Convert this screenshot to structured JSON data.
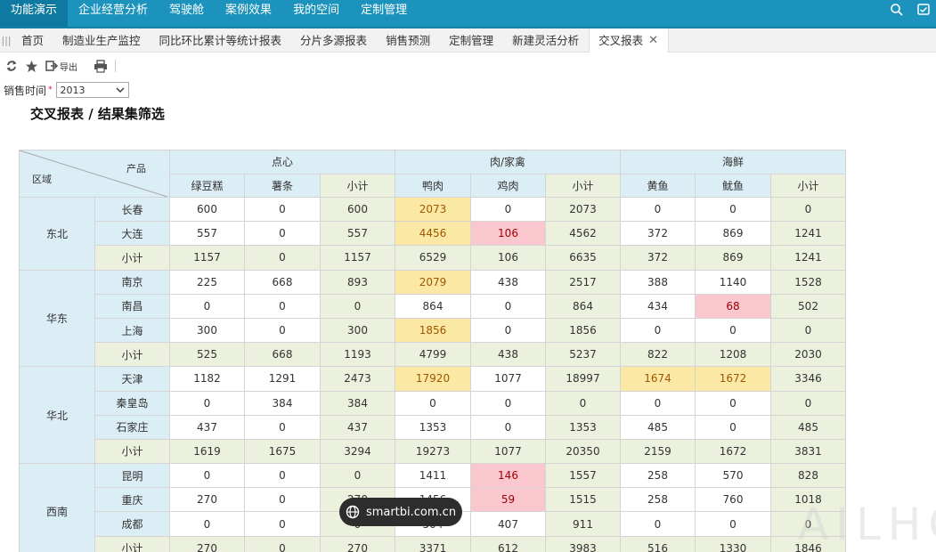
{
  "topnav": {
    "items": [
      "功能演示",
      "企业经营分析",
      "驾驶舱",
      "案例效果",
      "我的空间",
      "定制管理"
    ],
    "icons": [
      "search-icon",
      "message-icon"
    ]
  },
  "tabs": {
    "items": [
      "首页",
      "制造业生产监控",
      "同比环比累计等统计报表",
      "分片多源报表",
      "销售预测",
      "定制管理",
      "新建灵活分析",
      "交叉报表"
    ],
    "active": "交叉报表"
  },
  "toolbar": {
    "export_label": "导出",
    "icons": [
      "refresh-icon",
      "star-icon",
      "export-icon",
      "print-icon"
    ]
  },
  "filter": {
    "label": "销售时间",
    "required_mark": "*",
    "value": "2013"
  },
  "report": {
    "title": "交叉报表 / 结果集筛选",
    "corner_product": "产品",
    "corner_region": "区域",
    "groups": [
      "点心",
      "肉/家禽",
      "海鲜"
    ],
    "columns": [
      "绿豆糕",
      "薯条",
      "小计",
      "鸭肉",
      "鸡肉",
      "小计",
      "黄鱼",
      "鱿鱼",
      "小计"
    ],
    "regions": [
      {
        "name": "东北",
        "rows": [
          {
            "city": "长春",
            "values": [
              "600",
              "0",
              "600",
              "2073",
              "0",
              "2073",
              "0",
              "0",
              "0"
            ]
          },
          {
            "city": "大连",
            "values": [
              "557",
              "0",
              "557",
              "4456",
              "106",
              "4562",
              "372",
              "869",
              "1241"
            ]
          },
          {
            "city": "小计",
            "values": [
              "1157",
              "0",
              "1157",
              "6529",
              "106",
              "6635",
              "372",
              "869",
              "1241"
            ]
          }
        ]
      },
      {
        "name": "华东",
        "rows": [
          {
            "city": "南京",
            "values": [
              "225",
              "668",
              "893",
              "2079",
              "438",
              "2517",
              "388",
              "1140",
              "1528"
            ]
          },
          {
            "city": "南昌",
            "values": [
              "0",
              "0",
              "0",
              "864",
              "0",
              "864",
              "434",
              "68",
              "502"
            ]
          },
          {
            "city": "上海",
            "values": [
              "300",
              "0",
              "300",
              "1856",
              "0",
              "1856",
              "0",
              "0",
              "0"
            ]
          },
          {
            "city": "小计",
            "values": [
              "525",
              "668",
              "1193",
              "4799",
              "438",
              "5237",
              "822",
              "1208",
              "2030"
            ]
          }
        ]
      },
      {
        "name": "华北",
        "rows": [
          {
            "city": "天津",
            "values": [
              "1182",
              "1291",
              "2473",
              "17920",
              "1077",
              "18997",
              "1674",
              "1672",
              "3346"
            ]
          },
          {
            "city": "秦皇岛",
            "values": [
              "0",
              "384",
              "384",
              "0",
              "0",
              "0",
              "0",
              "0",
              "0"
            ]
          },
          {
            "city": "石家庄",
            "values": [
              "437",
              "0",
              "437",
              "1353",
              "0",
              "1353",
              "485",
              "0",
              "485"
            ]
          },
          {
            "city": "小计",
            "values": [
              "1619",
              "1675",
              "3294",
              "19273",
              "1077",
              "20350",
              "2159",
              "1672",
              "3831"
            ]
          }
        ]
      },
      {
        "name": "西南",
        "rows": [
          {
            "city": "昆明",
            "values": [
              "0",
              "0",
              "0",
              "1411",
              "146",
              "1557",
              "258",
              "570",
              "828"
            ]
          },
          {
            "city": "重庆",
            "values": [
              "270",
              "0",
              "270",
              "1456",
              "59",
              "1515",
              "258",
              "760",
              "1018"
            ]
          },
          {
            "city": "成都",
            "values": [
              "0",
              "0",
              "0",
              "504",
              "407",
              "911",
              "0",
              "0",
              "0"
            ]
          },
          {
            "city": "小计",
            "values": [
              "270",
              "0",
              "270",
              "3371",
              "612",
              "3983",
              "516",
              "1330",
              "1846"
            ]
          }
        ]
      }
    ],
    "highlight_colors": {
      "warning": "#fce8a5",
      "alert": "#fbc7cf"
    }
  },
  "watermark": {
    "pill_text": "smartbi.com.cn",
    "corner_text": "AILHC"
  }
}
